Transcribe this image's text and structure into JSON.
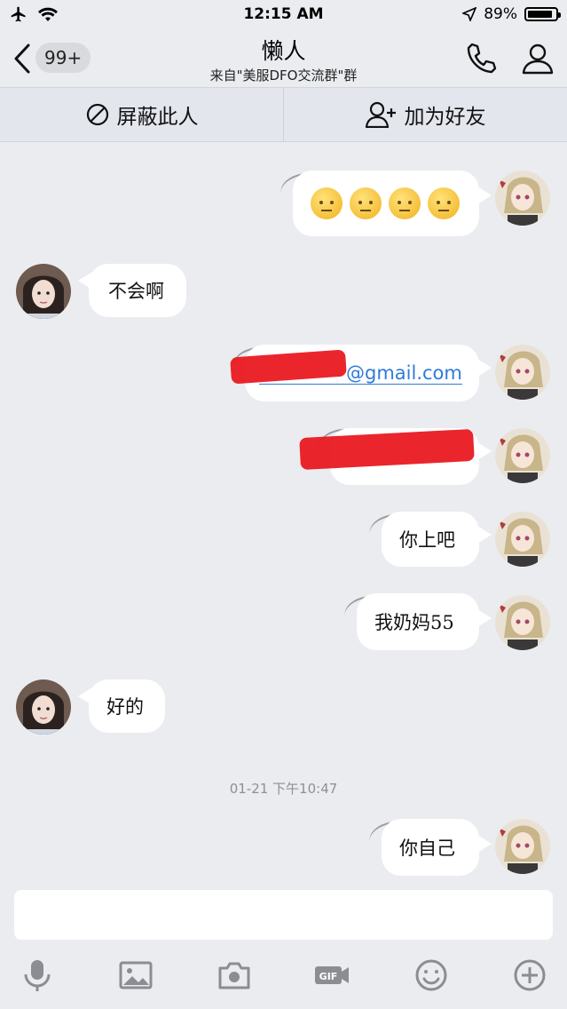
{
  "status": {
    "time": "12:15 AM",
    "battery": "89%",
    "battery_level": 0.89
  },
  "nav": {
    "back_badge": "99+",
    "title": "懒人",
    "subtitle": "来自\"美服DFO交流群\"群"
  },
  "actions": {
    "block_label": "屏蔽此人",
    "add_friend_label": "加为好友"
  },
  "messages": [
    {
      "side": "right",
      "type": "emoji",
      "emoji": [
        "slightly-smiling-face",
        "slightly-smiling-face",
        "slightly-smiling-face",
        "slightly-smiling-face"
      ]
    },
    {
      "side": "left",
      "text": "不会啊"
    },
    {
      "side": "right",
      "text": "@gmail.com",
      "redacted": true
    },
    {
      "side": "right",
      "text": "",
      "redacted": true
    },
    {
      "side": "right",
      "text": "你上吧"
    },
    {
      "side": "right",
      "text": "我奶妈55"
    },
    {
      "side": "left",
      "text": "好的"
    },
    {
      "side": "right",
      "text": "你自己"
    }
  ],
  "timestamp": "01-21 下午10:47",
  "toolbar": [
    "mic-icon",
    "image-icon",
    "camera-icon",
    "gif-icon",
    "emoji-icon",
    "plus-icon"
  ]
}
